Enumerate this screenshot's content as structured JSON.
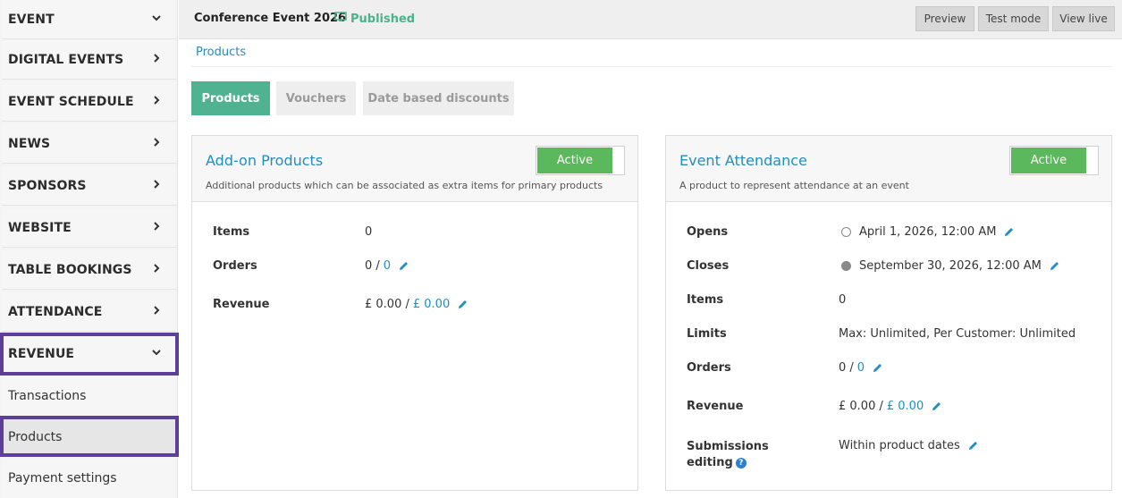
{
  "sidebar": {
    "items": [
      {
        "label": "EVENT",
        "chevron": "⌄"
      },
      {
        "label": "DIGITAL EVENTS",
        "chevron": "›"
      },
      {
        "label": "EVENT SCHEDULE",
        "chevron": "›"
      },
      {
        "label": "NEWS",
        "chevron": "›"
      },
      {
        "label": "SPONSORS",
        "chevron": "›"
      },
      {
        "label": "WEBSITE",
        "chevron": "›"
      },
      {
        "label": "TABLE BOOKINGS",
        "chevron": "›"
      },
      {
        "label": "ATTENDANCE",
        "chevron": "›"
      },
      {
        "label": "REVENUE",
        "chevron": "⌄"
      }
    ],
    "sub_items": [
      {
        "label": "Transactions"
      },
      {
        "label": "Products"
      },
      {
        "label": "Payment settings"
      }
    ]
  },
  "topbar": {
    "event_title": "Conference Event 2026",
    "status": "Published",
    "buttons": {
      "preview": "Preview",
      "test_mode": "Test mode",
      "view_live": "View live"
    }
  },
  "breadcrumb": "Products",
  "tabs": [
    "Products",
    "Vouchers",
    "Date based discounts"
  ],
  "addon": {
    "title": "Add-on Products",
    "subtitle": "Additional products which can be associated as extra items for primary products",
    "toggle": "Active",
    "rows": {
      "items_label": "Items",
      "items_value": "0",
      "orders_label": "Orders",
      "orders_value": "0 /",
      "orders_link": "0",
      "revenue_label": "Revenue",
      "revenue_value": "£ 0.00 /",
      "revenue_link": "£ 0.00"
    }
  },
  "attendance": {
    "title": "Event Attendance",
    "subtitle": "A product to represent attendance at an event",
    "toggle": "Active",
    "rows": {
      "opens_label": "Opens",
      "opens_value": "April 1, 2026, 12:00 AM",
      "closes_label": "Closes",
      "closes_value": "September 30, 2026, 12:00 AM",
      "items_label": "Items",
      "items_value": "0",
      "limits_label": "Limits",
      "limits_value": "Max: Unlimited, Per Customer: Unlimited",
      "orders_label": "Orders",
      "orders_value": "0 /",
      "orders_link": "0",
      "revenue_label": "Revenue",
      "revenue_value": "£ 0.00 /",
      "revenue_link": "£ 0.00",
      "submissions_label_1": "Submissions",
      "submissions_label_2": "editing",
      "submissions_value": "Within product dates"
    }
  },
  "colors": {
    "accent_green": "#4fb291",
    "link_blue": "#1f8ec0",
    "toggle_green": "#5cb85c",
    "highlight": "#5b3f9a"
  }
}
